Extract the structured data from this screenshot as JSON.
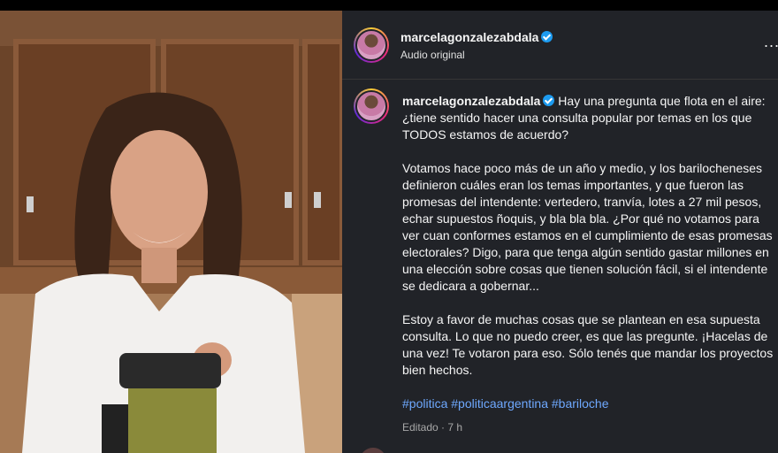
{
  "header": {
    "username": "marcelagonzalezabdala",
    "subtitle": "Audio original",
    "more_label": "..."
  },
  "caption": {
    "username": "marcelagonzalezabdala",
    "intro": "Hay una pregunta que flota en el aire: ¿tiene sentido hacer una consulta popular por temas en los que TODOS estamos de acuerdo?",
    "paragraph_2": "Votamos hace poco más de un año y medio, y los barilocheneses definieron cuáles eran los temas importantes, y que fueron las promesas del intendente: vertedero, tranvía, lotes a 27 mil pesos, echar supuestos ñoquis, y bla bla bla. ¿Por qué no votamos para ver cuan conformes estamos en el cumplimiento de esas promesas electorales? Digo, para que tenga algún sentido gastar millones en una elección sobre cosas que tienen solución fácil, si el intendente se dedicara a gobernar...",
    "paragraph_3": "Estoy a favor de muchas cosas que se plantean en esa supuesta consulta. Lo que no puedo creer, es que las pregunte. ¡Hacelas de una vez! Te votaron para eso. Sólo tenés que mandar los proyectos bien hechos.",
    "hashtags": "#politica #politicaargentina #bariloche",
    "edited": "Editado · 7 h"
  },
  "icons": {
    "verified": "verified-badge-icon",
    "more": "more-options-icon"
  },
  "colors": {
    "panel_bg": "#212328",
    "hashtag": "#6ea8fe",
    "verified": "#1d9bf0"
  }
}
